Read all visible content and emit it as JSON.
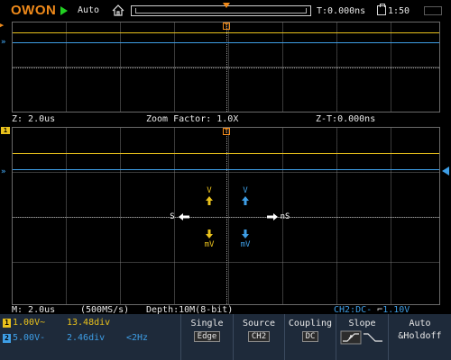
{
  "header": {
    "brand": "OWON",
    "trigger_mode": "Auto",
    "trigger_time": "T:0.000ns",
    "print_count": "1:50"
  },
  "zoom_window": {
    "zoom_timebase": "Z: 2.0us",
    "zoom_factor": "Zoom Factor: 1.0X",
    "zoom_trigger_time": "Z-T:0.000ns"
  },
  "main_window": {
    "pan_up_label": "V",
    "pan_down_label": "mV",
    "scale_left_label": "S",
    "scale_right_label": "nS"
  },
  "status_line": {
    "timebase": "M: 2.0us",
    "sample_rate": "(500MS/s)",
    "depth": "Depth:10M(8-bit)",
    "trigger_info": "CH2:DC- ",
    "trigger_level": "1.10V"
  },
  "channels": [
    {
      "tag": "1",
      "volts_div": "1.00V~",
      "offset": "13.48div",
      "color": "#e9c11c"
    },
    {
      "tag": "2",
      "volts_div": "5.00V-",
      "offset": "2.46div",
      "freq": "<2Hz",
      "color": "#3e9ee6"
    }
  ],
  "menu": {
    "type_label": "Single",
    "type_value": "Edge",
    "source_label": "Source",
    "source_value": "CH2",
    "coupling_label": "Coupling",
    "coupling_value": "DC",
    "slope_label": "Slope",
    "holdoff_line1": "Auto",
    "holdoff_line2": "&Holdoff"
  },
  "colors": {
    "brand": "#f08a1a",
    "ch1": "#e9c11c",
    "ch2": "#3e9ee6",
    "menu_bg": "#1e2a3a"
  }
}
